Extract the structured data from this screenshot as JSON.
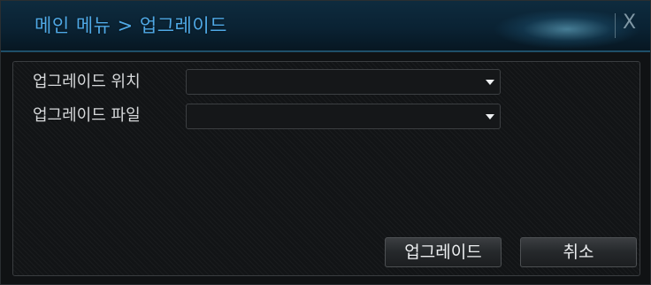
{
  "title": "메인 메뉴 > 업그레이드",
  "close_label": "X",
  "fields": [
    {
      "label": "업그레이드 위치",
      "value": ""
    },
    {
      "label": "업그레이드 파일",
      "value": ""
    }
  ],
  "buttons": {
    "upgrade": "업그레이드",
    "cancel": "취소"
  },
  "icons": {
    "close": "close-icon",
    "dropdown": "chevron-down-icon"
  },
  "colors": {
    "title_text": "#4fa9e6",
    "titlebar_bg": "#0a2233",
    "window_bg": "#101214"
  }
}
